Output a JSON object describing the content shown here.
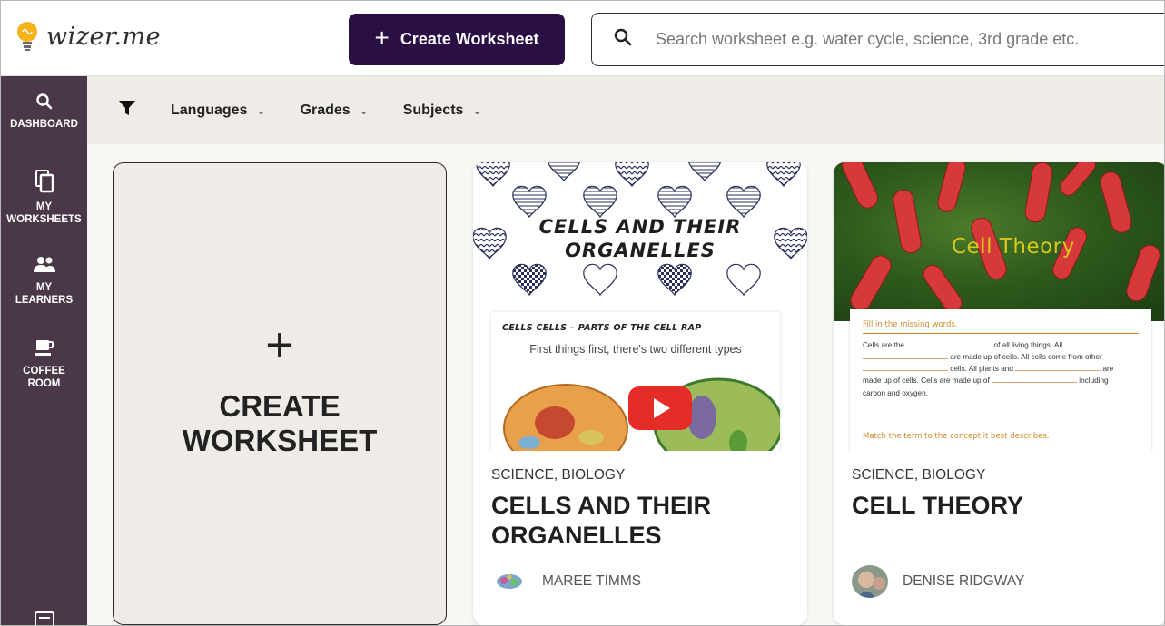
{
  "header": {
    "logo_text": "wizer.me",
    "create_button_label": "Create Worksheet",
    "search_placeholder": "Search worksheet e.g. water cycle, science, 3rd grade etc."
  },
  "sidebar": {
    "items": [
      {
        "label": "DASHBOARD",
        "icon": "search-icon"
      },
      {
        "label_line1": "MY",
        "label_line2": "WORKSHEETS",
        "icon": "copy-icon"
      },
      {
        "label_line1": "MY",
        "label_line2": "LEARNERS",
        "icon": "people-icon"
      },
      {
        "label_line1": "COFFEE",
        "label_line2": "ROOM",
        "icon": "coffee-icon"
      }
    ]
  },
  "filters": {
    "items": [
      {
        "label": "Languages"
      },
      {
        "label": "Grades"
      },
      {
        "label": "Subjects"
      }
    ]
  },
  "create_card": {
    "plus": "+",
    "label_line1": "CREATE",
    "label_line2": "WORKSHEET"
  },
  "cards": [
    {
      "subject": "SCIENCE, BIOLOGY",
      "title": "CELLS AND THEIR ORGANELLES",
      "author": "MAREE TIMMS",
      "thumb_title_line1": "CELLS AND THEIR",
      "thumb_title_line2": "ORGANELLES",
      "thumb_sheet_heading": "CELLS CELLS – PARTS OF THE CELL RAP",
      "thumb_sheet_line": "First things first, there's two different types"
    },
    {
      "subject": "SCIENCE, BIOLOGY",
      "title": "CELL THEORY",
      "author": "DENISE RIDGWAY",
      "thumb_title": "Cell Theory",
      "thumb_instruction": "Fill in the missing words.",
      "thumb_text_1": "Cells are the",
      "thumb_text_2": "of all living things. All",
      "thumb_text_3": "are made up of cells. All cells come from other",
      "thumb_text_4": "cells. All plants and",
      "thumb_text_5": "are",
      "thumb_text_6": "made up of cells. Cells are made up of",
      "thumb_text_7": "including",
      "thumb_text_8": "carbon and oxygen.",
      "thumb_footer": "Match the term to the concept it best describes."
    }
  ],
  "colors": {
    "brand_dark": "#2a0f45",
    "sidebar_bg": "#4a3849",
    "filter_bg": "#efece8",
    "youtube_red": "#e52d27"
  }
}
